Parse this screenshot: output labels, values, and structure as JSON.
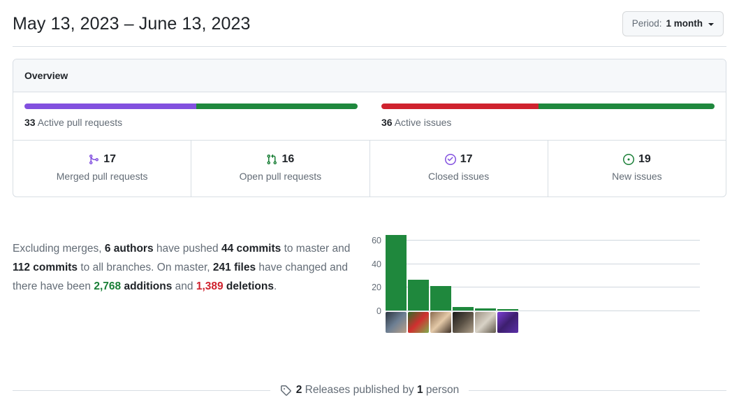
{
  "header": {
    "date_range": "May 13, 2023 – June 13, 2023",
    "period_button": {
      "label": "Period:",
      "value": "1 month",
      "caret_icon": "chevron-down-icon"
    }
  },
  "overview": {
    "title": "Overview",
    "pull_requests": {
      "count_text": "33",
      "label_text": " Active pull requests",
      "merged_color": "#8250df",
      "open_color": "#1f883d",
      "merged_percent": 51.5,
      "open_percent": 48.5
    },
    "issues": {
      "count_text": "36",
      "label_text": " Active issues",
      "closed_color": "#cf222e",
      "new_color": "#1f883d",
      "closed_percent": 47.2,
      "new_percent": 52.8
    },
    "stats": [
      {
        "icon": "git-merge-icon",
        "value": "17",
        "label": "Merged pull requests",
        "color": "#8250df"
      },
      {
        "icon": "git-pull-request-icon",
        "value": "16",
        "label": "Open pull requests",
        "color": "#1a7f37"
      },
      {
        "icon": "check-circle-icon",
        "value": "17",
        "label": "Closed issues",
        "color": "#8250df"
      },
      {
        "icon": "issue-opened-icon",
        "value": "19",
        "label": "New issues",
        "color": "#1a7f37"
      }
    ]
  },
  "commit_summary": {
    "intro": "Excluding merges, ",
    "authors": "6 authors",
    "pushed": " have pushed ",
    "commits_master": "44 commits",
    "to_master": " to master and ",
    "commits_all": "112 commits",
    "to_all": " to all branches. On master, ",
    "files": "241 files",
    "changed": " have changed and there have been ",
    "additions_number": "2,768",
    "additions_word": " additions",
    "and": " and ",
    "deletions_number": "1,389",
    "deletions_word": " deletions",
    "period": "."
  },
  "chart_data": {
    "type": "bar",
    "title": "",
    "xlabel": "",
    "ylabel": "",
    "ylim": [
      0,
      70
    ],
    "yticks": [
      0,
      20,
      40,
      60
    ],
    "grid": true,
    "legend": "none",
    "categories": [
      "author-1",
      "author-2",
      "author-3",
      "author-4",
      "author-5",
      "author-6"
    ],
    "values": [
      64,
      26,
      21,
      3,
      2,
      1
    ],
    "bar_color": "#1f883d",
    "x_axis_type": "avatars",
    "avatars": [
      {
        "name": "contributor-avatar-1",
        "colors": [
          "#2b3440",
          "#6d7f93",
          "#b9a089"
        ]
      },
      {
        "name": "contributor-avatar-2",
        "colors": [
          "#2f6b2a",
          "#d12f2f",
          "#7fae4e"
        ]
      },
      {
        "name": "contributor-avatar-3",
        "colors": [
          "#8a6b4f",
          "#e4c9a8",
          "#3d2f25"
        ]
      },
      {
        "name": "contributor-avatar-4",
        "colors": [
          "#1a1a1a",
          "#5a5145",
          "#b0a18c"
        ]
      },
      {
        "name": "contributor-avatar-5",
        "colors": [
          "#9b9183",
          "#d8d2c6",
          "#5f574a"
        ]
      },
      {
        "name": "contributor-avatar-6",
        "colors": [
          "#7b3fd4",
          "#3d1f6e",
          "#5b2fa8"
        ]
      }
    ]
  },
  "releases": {
    "icon": "tag-icon",
    "count": "2",
    "text_middle": " Releases published by ",
    "person_count": "1",
    "text_end": " person"
  }
}
